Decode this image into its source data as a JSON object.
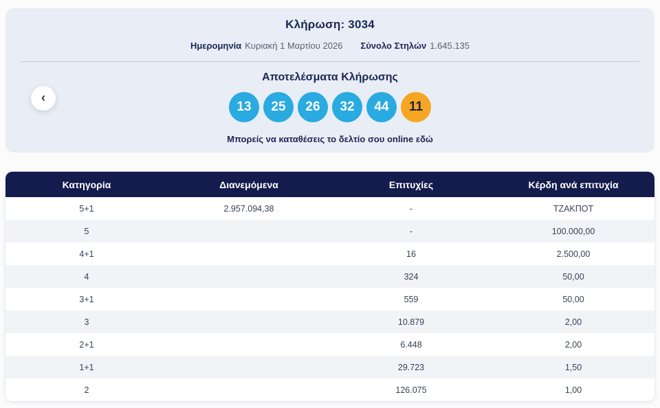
{
  "header_card": {
    "title": "Κλήρωση: 3034",
    "date_label": "Ημερομηνία",
    "date_value": "Κυριακή 1 Μαρτίου 2026",
    "columns_label": "Σύνολο Στηλών",
    "columns_value": "1.645.135",
    "results_title": "Αποτελέσματα Κλήρωσης",
    "deposit_link_label": "Μπορείς να καταθέσεις το δελτίο σου online εδώ"
  },
  "results": {
    "numbers": [
      "13",
      "25",
      "26",
      "32",
      "44"
    ],
    "bonus": "11"
  },
  "icons": {
    "chevron_left": "‹"
  },
  "table": {
    "headers": [
      "Κατηγορία",
      "Διανεμόμενα",
      "Επιτυχίες",
      "Κέρδη ανά επιτυχία"
    ],
    "rows": [
      {
        "category": "5+1",
        "distributed": "2.957.094,38",
        "winners": "-",
        "prize": "ΤΖΑΚΠΟΤ"
      },
      {
        "category": "5",
        "distributed": "",
        "winners": "-",
        "prize": "100.000,00"
      },
      {
        "category": "4+1",
        "distributed": "",
        "winners": "16",
        "prize": "2.500,00"
      },
      {
        "category": "4",
        "distributed": "",
        "winners": "324",
        "prize": "50,00"
      },
      {
        "category": "3+1",
        "distributed": "",
        "winners": "559",
        "prize": "50,00"
      },
      {
        "category": "3",
        "distributed": "",
        "winners": "10.879",
        "prize": "2,00"
      },
      {
        "category": "2+1",
        "distributed": "",
        "winners": "6.448",
        "prize": "2,00"
      },
      {
        "category": "1+1",
        "distributed": "",
        "winners": "29.723",
        "prize": "1,50"
      },
      {
        "category": "2",
        "distributed": "",
        "winners": "126.075",
        "prize": "1,00"
      }
    ]
  },
  "colors": {
    "card_background": "#e9edf5",
    "navy_text": "#1b2653",
    "table_header_background": "#141b4d",
    "number_ball": "#29aae1",
    "bonus_ball": "#f6a623",
    "alt_row": "#f2f3f7"
  }
}
